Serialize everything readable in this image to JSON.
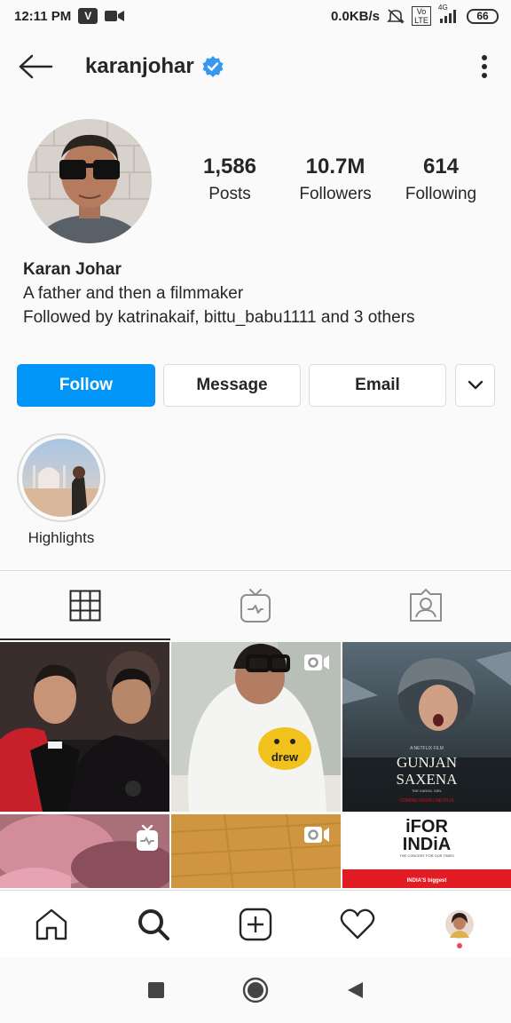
{
  "status_bar": {
    "time": "12:11 PM",
    "app_badge": "V",
    "network_speed": "0.0KB/s",
    "volte_label": "Vo LTE",
    "network_type": "4G",
    "battery": "66",
    "icons": [
      "video-icon",
      "mute-icon",
      "signal-icon"
    ]
  },
  "header": {
    "username": "karanjohar",
    "verified": true,
    "icons": [
      "back-arrow-icon",
      "verified-icon",
      "more-vertical-icon"
    ]
  },
  "profile": {
    "stats": [
      {
        "value": "1,586",
        "label": "Posts"
      },
      {
        "value": "10.7M",
        "label": "Followers"
      },
      {
        "value": "614",
        "label": "Following"
      }
    ]
  },
  "bio": {
    "name": "Karan Johar",
    "description": "A father and then a filmmaker",
    "followed_by_prefix": "Followed by ",
    "followed_by_users": "katrinakaif, bittu_babu1111",
    "followed_by_suffix": " and 3  others"
  },
  "actions": {
    "follow": "Follow",
    "message": "Message",
    "email": "Email",
    "more_icon": "chevron-down-icon"
  },
  "highlights": [
    {
      "label": "Highlights"
    }
  ],
  "tabs": [
    {
      "name": "posts",
      "icon": "grid-icon",
      "active": true
    },
    {
      "name": "igtv",
      "icon": "igtv-icon",
      "active": false
    },
    {
      "name": "tagged",
      "icon": "tagged-icon",
      "active": false
    }
  ],
  "grid": {
    "tiles": [
      {
        "badge": null
      },
      {
        "badge": "video-icon",
        "mug_text": "drew"
      },
      {
        "badge": null,
        "poster_tag": "A NETFLIX FILM",
        "poster_title_1": "GUNJAN",
        "poster_title_2": "SAXENA",
        "poster_sub": "THE KARGIL GIRL",
        "poster_footer": "COMING SOON | NETFLIX"
      },
      {
        "badge": "igtv-icon"
      },
      {
        "badge": "video-icon"
      },
      {
        "badge": null,
        "poster_title_1": "iFOR",
        "poster_title_2": "INDiA",
        "poster_sub": "THE CONCERT FOR OUR TIMES",
        "poster_footer": "INDIA'S biggest"
      }
    ]
  },
  "bottom_nav": [
    "home-icon",
    "search-icon",
    "add-icon",
    "heart-icon",
    "profile-avatar"
  ],
  "android_nav": [
    "recents-icon",
    "home-circle-icon",
    "back-triangle-icon"
  ],
  "colors": {
    "accent": "#0095f6",
    "verified": "#3897f0",
    "notification_dot": "#ed4956",
    "netflix_red": "#e50914"
  }
}
